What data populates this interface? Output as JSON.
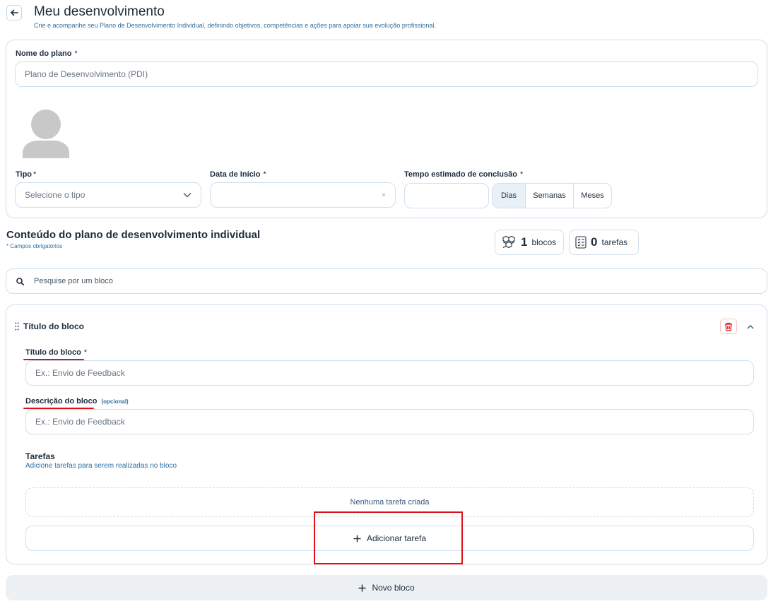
{
  "header": {
    "title": "Meu desenvolvimento",
    "subtitle": "Crie e acompanhe seu Plano de Desenvolvimento Individual, definindo objetivos, competências e ações para apoiar sua evolução profissional."
  },
  "plan": {
    "name_label": "Nome do plano",
    "name_value": "Plano de Desenvolvimento (PDI)",
    "type_label": "Tipo",
    "type_placeholder": "Selecione o tipo",
    "start_label": "Data de Início",
    "start_clear": "×",
    "duration_label": "Tempo estimado de conclusão",
    "required_mark": "*",
    "units": [
      "Dias",
      "Semanas",
      "Meses"
    ]
  },
  "content": {
    "title": "Conteúdo do plano de desenvolvimento individual",
    "note": "* Campos obrigatórios",
    "blocks_count": "1",
    "blocks_word": "blocos",
    "tasks_count": "0",
    "tasks_word": "tarefas",
    "search_placeholder": "Pesquise por um bloco"
  },
  "block": {
    "header_title": "Título do bloco",
    "title_label": "Título do bloco",
    "title_placeholder": "Ex.: Envio de Feedback",
    "desc_label": "Descrição do bloco",
    "desc_optional": "(opcional)",
    "desc_placeholder": "Ex.: Envio de Feedback",
    "tasks_title": "Tarefas",
    "tasks_subtitle": "Adicione tarefas para serem realizadas no bloco",
    "no_tasks": "Nenhuma tarefa criada",
    "add_task": "Adicionar tarefa"
  },
  "new_block_label": "Novo bloco",
  "colors": {
    "accent": "#2f6f9f",
    "danger": "#e0101a",
    "border": "#cfe0ee"
  },
  "icons": [
    "arrow-left-icon",
    "avatar-placeholder",
    "chevron-down-icon",
    "cubes-icon",
    "checklist-icon",
    "search-icon",
    "drag-handle-icon",
    "trash-icon",
    "chevron-up-icon",
    "plus-icon"
  ]
}
